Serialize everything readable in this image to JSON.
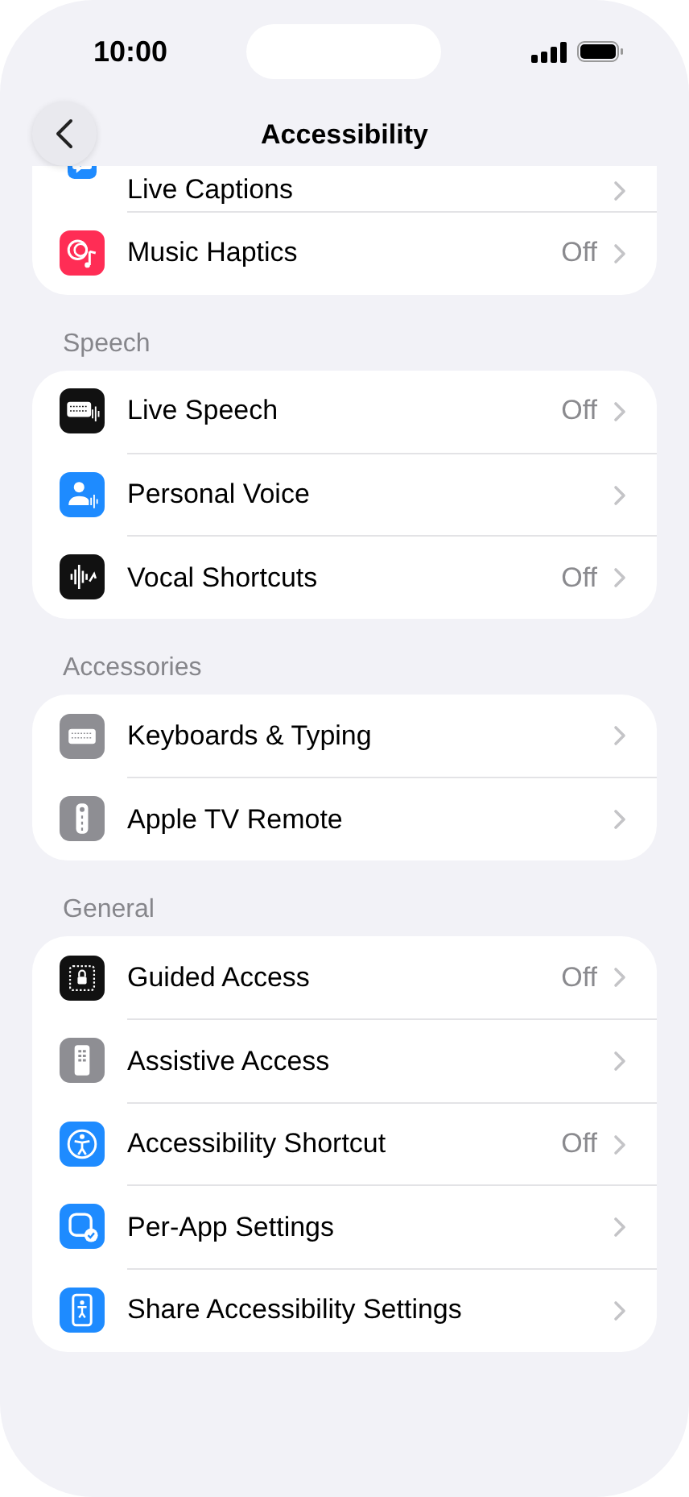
{
  "status_bar": {
    "time": "10:00"
  },
  "nav": {
    "title": "Accessibility"
  },
  "sections": [
    {
      "items": [
        {
          "label": "Live Captions"
        },
        {
          "label": "Music Haptics",
          "value": "Off"
        }
      ]
    },
    {
      "header": "Speech",
      "items": [
        {
          "label": "Live Speech",
          "value": "Off"
        },
        {
          "label": "Personal Voice"
        },
        {
          "label": "Vocal Shortcuts",
          "value": "Off"
        }
      ]
    },
    {
      "header": "Accessories",
      "items": [
        {
          "label": "Keyboards & Typing"
        },
        {
          "label": "Apple TV Remote"
        }
      ]
    },
    {
      "header": "General",
      "items": [
        {
          "label": "Guided Access",
          "value": "Off"
        },
        {
          "label": "Assistive Access"
        },
        {
          "label": "Accessibility Shortcut",
          "value": "Off"
        },
        {
          "label": "Per-App Settings"
        },
        {
          "label": "Share Accessibility Settings"
        }
      ]
    }
  ]
}
